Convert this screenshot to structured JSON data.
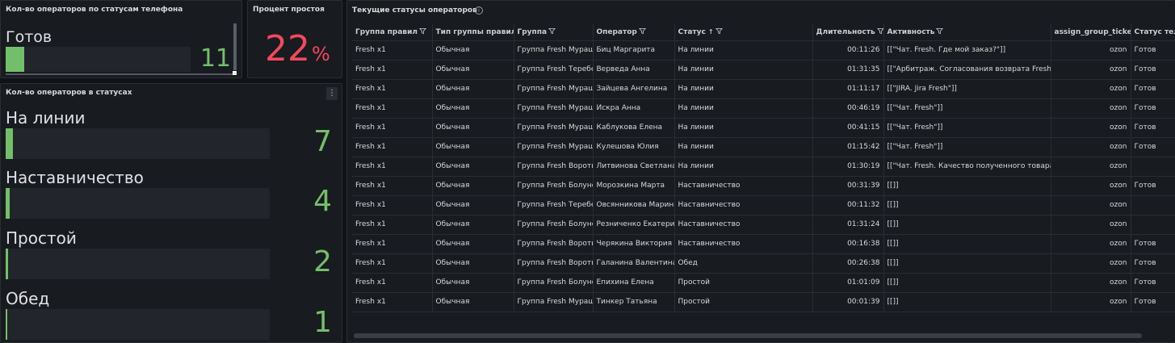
{
  "panel_phone": {
    "title": "Кол-во операторов по статусам телефона",
    "label": "Готов",
    "value": "11",
    "fill_fraction": 0.04
  },
  "panel_idle": {
    "title": "Процент простоя",
    "value": "22",
    "unit": "%"
  },
  "panel_status": {
    "title": "Кол-во операторов в статусах",
    "menu_icon": "kebab-menu-icon",
    "rows": [
      {
        "label": "На линии",
        "value": "7",
        "fill_fraction": 0.028
      },
      {
        "label": "Наставничество",
        "value": "4",
        "fill_fraction": 0.016
      },
      {
        "label": "Простой",
        "value": "2",
        "fill_fraction": 0.008
      },
      {
        "label": "Обед",
        "value": "1",
        "fill_fraction": 0.004
      }
    ]
  },
  "panel_table": {
    "title": "Текущие статусы операторов",
    "info_icon": "info-icon",
    "filter_icon": "filter-icon",
    "sort_icon": "sort-ascending-icon",
    "columns": [
      "Группа правил",
      "Тип группы правил",
      "Группа",
      "Оператор",
      "Статус",
      "Длительность",
      "Активность",
      "assign_group_ticket",
      "Статус телефона"
    ],
    "rows": [
      [
        "Fresh x1",
        "Обычная",
        "Группа Fresh Мурашино",
        "Биц Маргарита",
        "На линии",
        "00:11:26",
        "[[\"Чат. Fresh. Где мой заказ?\"]]",
        "ozon",
        "Готов"
      ],
      [
        "Fresh x1",
        "Обычная",
        "Группа Fresh Теребенево",
        "Верведа Анна",
        "На линии",
        "01:31:35",
        "[[\"Арбитраж. Согласования возврата Fresh\"]]",
        "ozon",
        "Готов"
      ],
      [
        "Fresh x1",
        "Обычная",
        "Группа Fresh Мурашино",
        "Зайцева Ангелина",
        "На линии",
        "01:11:17",
        "[[\"JIRA. Jira Fresh\"]]",
        "ozon",
        "Готов"
      ],
      [
        "Fresh x1",
        "Обычная",
        "Группа Fresh Мурашино",
        "Искра Анна",
        "На линии",
        "00:46:19",
        "[[\"Чат. Fresh\"]]",
        "ozon",
        "Готов"
      ],
      [
        "Fresh x1",
        "Обычная",
        "Группа Fresh Мурашино",
        "Каблукова Елена",
        "На линии",
        "00:41:15",
        "[[\"Чат. Fresh\"]]",
        "ozon",
        "Готов"
      ],
      [
        "Fresh x1",
        "Обычная",
        "Группа Fresh Мурашино",
        "Кулешова Юлия",
        "На линии",
        "01:15:42",
        "[[\"Чат. Fresh\"]]",
        "ozon",
        "Готов"
      ],
      [
        "Fresh x1",
        "Обычная",
        "Группа Fresh Воротынск",
        "Литвинова Светлана",
        "На линии",
        "01:30:19",
        "[[\"Чат. Fresh. Качество полученного товара\"]]",
        "ozon",
        ""
      ],
      [
        "Fresh x1",
        "Обычная",
        "Группа Fresh Болунец",
        "Морозкина Марта",
        "Наставничество",
        "00:31:39",
        "[[]]",
        "ozon",
        "Готов"
      ],
      [
        "Fresh x1",
        "Обычная",
        "Группа Fresh Теребенево",
        "Овсянникова Марина",
        "Наставничество",
        "00:11:32",
        "[[]]",
        "ozon",
        ""
      ],
      [
        "Fresh x1",
        "Обычная",
        "Группа Fresh Болунец",
        "Резниченко Екатерина",
        "Наставничество",
        "01:31:24",
        "[[]]",
        "ozon",
        ""
      ],
      [
        "Fresh x1",
        "Обычная",
        "Группа Fresh Воротынск",
        "Черякина Виктория",
        "Наставничество",
        "00:16:38",
        "[[]]",
        "ozon",
        "Готов"
      ],
      [
        "Fresh x1",
        "Обычная",
        "Группа Fresh Воротынск",
        "Галанина Валентина",
        "Обед",
        "00:26:38",
        "[[]]",
        "ozon",
        "Готов"
      ],
      [
        "Fresh x1",
        "Обычная",
        "Группа Fresh Болунец",
        "Епихина Елена",
        "Простой",
        "01:01:09",
        "[[]]",
        "ozon",
        "Готов"
      ],
      [
        "Fresh x1",
        "Обычная",
        "Группа Fresh Мурашино",
        "Тинкер Татьяна",
        "Простой",
        "00:01:39",
        "[[]]",
        "ozon",
        "Готов"
      ]
    ]
  },
  "colors": {
    "background": "#111217",
    "panel": "#181b1f",
    "green": "#73bf69",
    "red": "#f2495c"
  }
}
